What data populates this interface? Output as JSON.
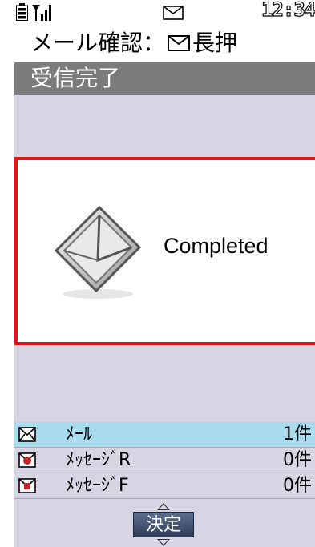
{
  "status": {
    "clock": "12:34",
    "battery_icon": "battery-icon",
    "signal_icon": "signal-icon",
    "mail_icon": "mail-icon"
  },
  "title": {
    "prefix": "メール確認：",
    "suffix": "長押",
    "icon": "mail-icon"
  },
  "subheader": "受信完了",
  "dialog": {
    "message": "Completed",
    "icon": "envelope-icon",
    "border_color": "#e8141c"
  },
  "list": [
    {
      "icon": "mail-icon",
      "label": "ﾒｰﾙ",
      "count": "1件",
      "selected": true
    },
    {
      "icon": "message-r-icon",
      "label": "ﾒｯｾｰｼﾞR",
      "count": "0件",
      "selected": false
    },
    {
      "icon": "message-f-icon",
      "label": "ﾒｯｾｰｼﾞF",
      "count": "0件",
      "selected": false
    }
  ],
  "softkey": {
    "label": "決定"
  },
  "colors": {
    "background": "#d7d4e3",
    "selected_row": "#a8dcee",
    "subheader": "#7c7c7c"
  }
}
